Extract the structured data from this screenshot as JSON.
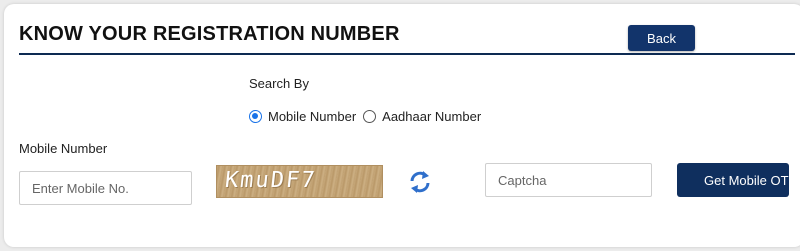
{
  "header": {
    "title": "KNOW YOUR REGISTRATION NUMBER",
    "back_label": "Back"
  },
  "search": {
    "label": "Search By",
    "options": [
      {
        "label": "Mobile Number",
        "selected": true
      },
      {
        "label": "Aadhaar Number",
        "selected": false
      }
    ]
  },
  "form": {
    "mobile_label": "Mobile Number",
    "mobile_placeholder": "Enter Mobile No.",
    "mobile_value": "",
    "captcha_text": "KmuDF7",
    "captcha_placeholder": "Captcha",
    "captcha_value": "",
    "submit_label": "Get Mobile OTP"
  },
  "colors": {
    "primary": "#12346b",
    "radio_accent": "#1a73e8",
    "refresh_icon": "#2f6fcb"
  }
}
